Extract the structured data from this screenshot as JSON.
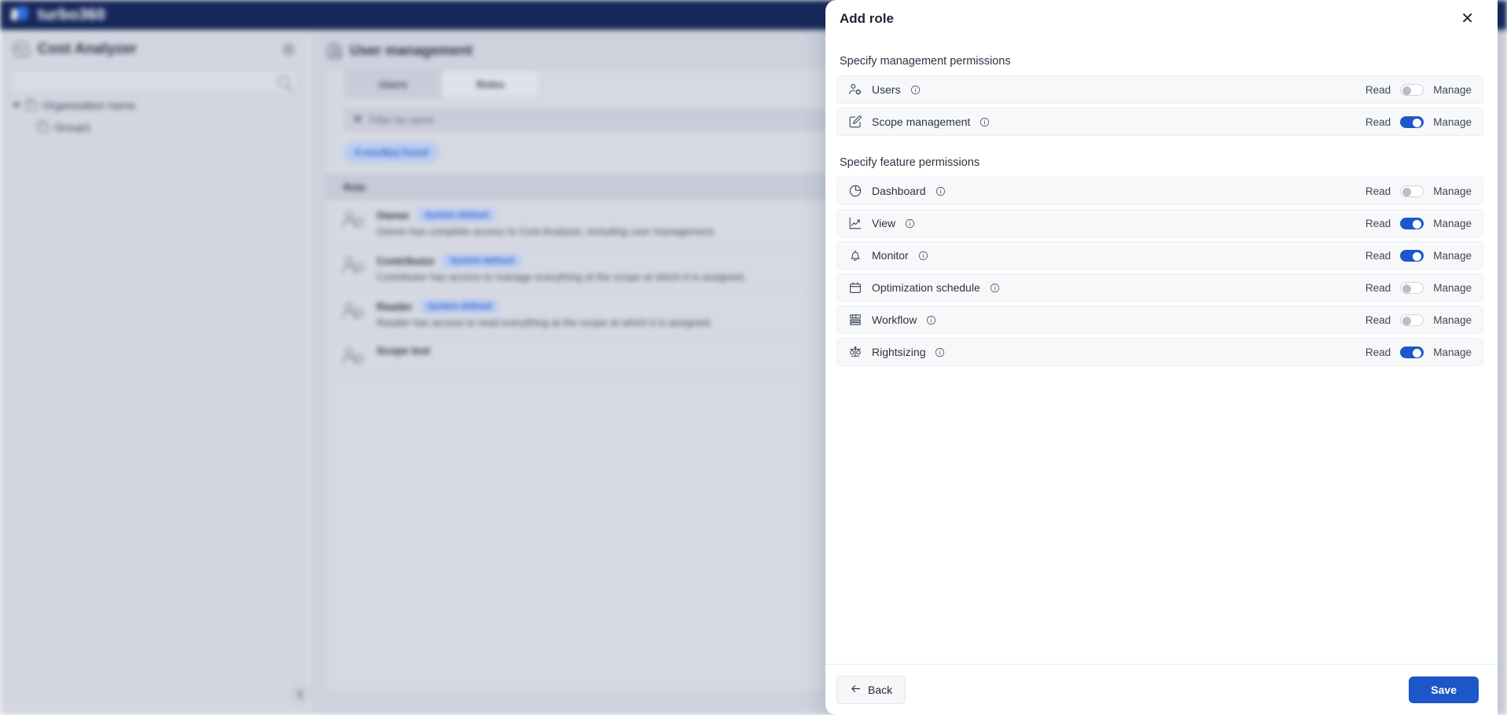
{
  "background": {
    "topbar": {
      "brand": "turbo360",
      "logo_icon": "turbo360-logo-icon"
    },
    "sidebar": {
      "title": "Cost Analyzer",
      "gear_icon": "gear-icon",
      "search_placeholder": "",
      "search_icon": "search-icon",
      "tree": [
        {
          "label": "Organisation name",
          "indent": false
        },
        {
          "label": "Group1",
          "indent": true
        }
      ],
      "collapse_icon": "chevron-left-icon"
    },
    "main": {
      "page_title": "User management",
      "page_icon": "user-circle-icon",
      "tabs": [
        {
          "label": "Users",
          "active": false
        },
        {
          "label": "Roles",
          "active": true
        }
      ],
      "filter_placeholder": "Filter by name",
      "filter_icon": "funnel-icon",
      "results_chip": "4 result(s) found",
      "table_header": "Role",
      "roles": [
        {
          "name": "Owner",
          "badge": "System defined",
          "description": "Owner has complete access to Cost Analyzer, including user management."
        },
        {
          "name": "Contributor",
          "badge": "System defined",
          "description": "Contributor has access to manage everything at the scope at which it is assigned."
        },
        {
          "name": "Reader",
          "badge": "System defined",
          "description": "Reader has access to read everything at the scope at which it is assigned."
        },
        {
          "name": "Scope test",
          "badge": "",
          "description": ""
        }
      ]
    }
  },
  "modal": {
    "title": "Add role",
    "close_icon": "close-icon",
    "management_section": {
      "title": "Specify management permissions",
      "rows": [
        {
          "label": "Users",
          "icon": "user-gear-icon",
          "info_icon": "info-icon",
          "read_label": "Read",
          "manage_label": "Manage",
          "toggle_state": "off"
        },
        {
          "label": "Scope management",
          "icon": "pencil-square-icon",
          "info_icon": "info-icon",
          "read_label": "Read",
          "manage_label": "Manage",
          "toggle_state": "on"
        }
      ]
    },
    "feature_section": {
      "title": "Specify feature permissions",
      "rows": [
        {
          "label": "Dashboard",
          "icon": "pie-chart-icon",
          "info_icon": "info-icon",
          "read_label": "Read",
          "manage_label": "Manage",
          "toggle_state": "off"
        },
        {
          "label": "View",
          "icon": "line-chart-icon",
          "info_icon": "info-icon",
          "read_label": "Read",
          "manage_label": "Manage",
          "toggle_state": "on"
        },
        {
          "label": "Monitor",
          "icon": "bell-icon",
          "info_icon": "info-icon",
          "read_label": "Read",
          "manage_label": "Manage",
          "toggle_state": "on"
        },
        {
          "label": "Optimization schedule",
          "icon": "calendar-icon",
          "info_icon": "info-icon",
          "read_label": "Read",
          "manage_label": "Manage",
          "toggle_state": "off"
        },
        {
          "label": "Workflow",
          "icon": "workflow-icon",
          "info_icon": "info-icon",
          "read_label": "Read",
          "manage_label": "Manage",
          "toggle_state": "off"
        },
        {
          "label": "Rightsizing",
          "icon": "scales-icon",
          "info_icon": "info-icon",
          "read_label": "Read",
          "manage_label": "Manage",
          "toggle_state": "on"
        }
      ]
    },
    "footer": {
      "back_label": "Back",
      "back_icon": "arrow-left-icon",
      "save_label": "Save"
    }
  },
  "colors": {
    "brand_navy": "#17295a",
    "accent_blue": "#1d56c9",
    "chip_blue_bg": "#b9ccf2",
    "chip_blue_text": "#2a5bc4",
    "row_bg": "#f7f8fa"
  }
}
